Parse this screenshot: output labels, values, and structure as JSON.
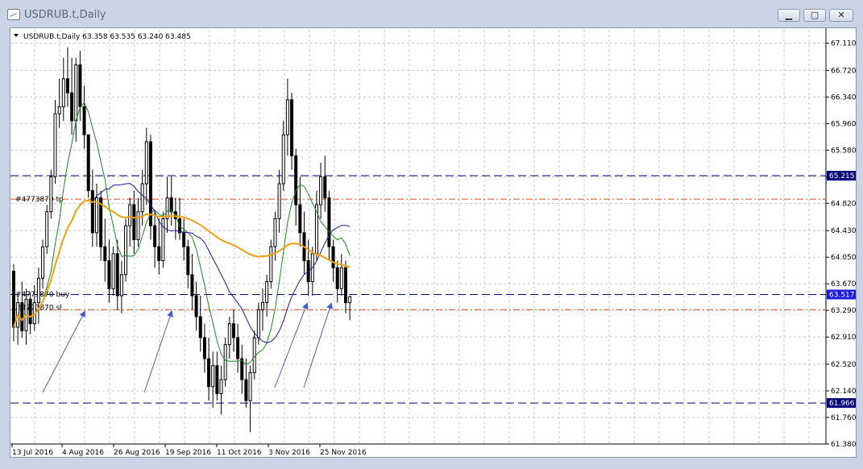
{
  "window": {
    "title": "USDRUB.t,Daily",
    "minimize_icon": "minimize-icon",
    "maximize_icon": "maximize-icon",
    "close_icon": "close-icon"
  },
  "header": {
    "symbol": "USDRUB.t,Daily",
    "ohlc": "63.358 63.535 63.240 63.485"
  },
  "chart_data": {
    "type": "candlestick",
    "title": "USDRUB.t,Daily",
    "ylim": [
      61.38,
      67.3
    ],
    "y_ticks": [
      "67.110",
      "66.720",
      "66.340",
      "65.960",
      "65.580",
      "65.200",
      "64.820",
      "64.430",
      "64.050",
      "63.670",
      "63.290",
      "62.910",
      "62.520",
      "62.140",
      "61.760",
      "61.380"
    ],
    "x_ticks": [
      "13 Jul 2016",
      "4 Aug 2016",
      "26 Aug 2016",
      "19 Sep 2016",
      "11 Oct 2016",
      "3 Nov 2016",
      "25 Nov 2016"
    ],
    "horizontal_levels": [
      {
        "label": "65.215",
        "value": 65.215,
        "style": "dashed",
        "color": "#000080"
      },
      {
        "label": "",
        "value": 64.88,
        "style": "dashdot",
        "color": "#e05020"
      },
      {
        "label": "63.517",
        "value": 63.517,
        "style": "dashed",
        "color": "#000080"
      },
      {
        "label": "",
        "value": 63.3,
        "style": "dashdot",
        "color": "#e05020"
      },
      {
        "label": "61.966",
        "value": 61.966,
        "style": "dashed",
        "color": "#000080"
      }
    ],
    "order_labels": [
      "#4773870 tp",
      "#4773870 buy",
      "#4773870 sl"
    ],
    "candles": [
      [
        63.85,
        63.95,
        62.85,
        63.05
      ],
      [
        63.05,
        63.5,
        62.8,
        63.4
      ],
      [
        63.4,
        63.7,
        62.9,
        63.0
      ],
      [
        63.0,
        63.6,
        62.8,
        63.45
      ],
      [
        63.45,
        63.55,
        62.95,
        63.1
      ],
      [
        63.1,
        63.65,
        63.0,
        63.4
      ],
      [
        63.4,
        63.9,
        63.1,
        63.75
      ],
      [
        63.75,
        64.3,
        63.6,
        64.2
      ],
      [
        64.2,
        64.8,
        64.1,
        64.7
      ],
      [
        64.7,
        65.3,
        64.6,
        65.2
      ],
      [
        65.2,
        66.3,
        65.1,
        66.1
      ],
      [
        66.1,
        66.6,
        65.9,
        66.2
      ],
      [
        66.2,
        66.9,
        66.0,
        66.6
      ],
      [
        66.6,
        67.05,
        66.2,
        66.4
      ],
      [
        66.4,
        66.9,
        65.8,
        66.0
      ],
      [
        66.0,
        66.9,
        65.7,
        66.8
      ],
      [
        66.8,
        67.0,
        66.0,
        66.2
      ],
      [
        66.2,
        66.5,
        65.6,
        65.8
      ],
      [
        65.8,
        65.8,
        64.9,
        65.0
      ],
      [
        65.0,
        65.3,
        64.2,
        64.4
      ],
      [
        64.4,
        65.1,
        64.2,
        64.9
      ],
      [
        64.9,
        65.0,
        64.0,
        64.2
      ],
      [
        64.2,
        64.6,
        63.7,
        64.0
      ],
      [
        64.0,
        64.3,
        63.4,
        63.6
      ],
      [
        63.6,
        64.2,
        63.5,
        64.1
      ],
      [
        64.1,
        64.3,
        63.3,
        63.5
      ],
      [
        63.5,
        64.0,
        63.25,
        63.8
      ],
      [
        63.8,
        64.6,
        63.7,
        64.5
      ],
      [
        64.5,
        64.9,
        64.2,
        64.8
      ],
      [
        64.8,
        65.0,
        64.1,
        64.3
      ],
      [
        64.3,
        64.9,
        64.2,
        64.7
      ],
      [
        64.7,
        65.3,
        64.5,
        65.1
      ],
      [
        65.1,
        65.9,
        64.8,
        65.7
      ],
      [
        65.7,
        65.8,
        64.3,
        64.5
      ],
      [
        64.5,
        64.7,
        63.9,
        64.2
      ],
      [
        64.2,
        64.6,
        63.8,
        64.0
      ],
      [
        64.0,
        64.7,
        63.9,
        64.6
      ],
      [
        64.6,
        65.2,
        64.4,
        64.9
      ],
      [
        64.9,
        65.2,
        64.5,
        64.7
      ],
      [
        64.7,
        64.9,
        64.3,
        64.6
      ],
      [
        64.6,
        64.9,
        64.3,
        64.4
      ],
      [
        64.4,
        64.6,
        64.0,
        64.2
      ],
      [
        64.2,
        64.3,
        63.6,
        63.8
      ],
      [
        63.8,
        64.1,
        63.3,
        63.5
      ],
      [
        63.5,
        63.7,
        63.0,
        63.2
      ],
      [
        63.2,
        63.5,
        62.7,
        62.9
      ],
      [
        62.9,
        63.1,
        62.4,
        62.6
      ],
      [
        62.6,
        62.9,
        62.0,
        62.2
      ],
      [
        62.2,
        62.7,
        61.9,
        62.5
      ],
      [
        62.5,
        62.7,
        62.0,
        62.1
      ],
      [
        62.1,
        62.5,
        61.8,
        62.3
      ],
      [
        62.3,
        62.9,
        62.2,
        62.8
      ],
      [
        62.8,
        63.2,
        62.6,
        63.1
      ],
      [
        63.1,
        63.3,
        62.7,
        62.9
      ],
      [
        62.9,
        63.1,
        62.4,
        62.6
      ],
      [
        62.6,
        62.8,
        62.1,
        62.3
      ],
      [
        62.3,
        62.6,
        61.9,
        62.0
      ],
      [
        62.0,
        62.5,
        61.55,
        62.4
      ],
      [
        62.4,
        63.0,
        62.3,
        62.9
      ],
      [
        62.9,
        63.4,
        62.8,
        63.3
      ],
      [
        63.3,
        63.6,
        63.0,
        63.4
      ],
      [
        63.4,
        63.8,
        63.2,
        63.7
      ],
      [
        63.7,
        64.3,
        63.6,
        64.2
      ],
      [
        64.2,
        64.7,
        64.0,
        64.6
      ],
      [
        64.6,
        65.3,
        64.4,
        65.1
      ],
      [
        65.1,
        66.0,
        65.0,
        65.8
      ],
      [
        65.8,
        66.6,
        65.5,
        66.3
      ],
      [
        66.3,
        66.4,
        65.3,
        65.5
      ],
      [
        65.5,
        65.6,
        64.5,
        64.8
      ],
      [
        64.8,
        65.2,
        64.2,
        64.4
      ],
      [
        64.4,
        64.7,
        63.8,
        64.0
      ],
      [
        64.0,
        64.3,
        63.5,
        63.7
      ],
      [
        63.7,
        64.2,
        63.5,
        64.1
      ],
      [
        64.1,
        65.0,
        64.0,
        64.8
      ],
      [
        64.8,
        65.4,
        64.6,
        65.2
      ],
      [
        65.2,
        65.5,
        64.7,
        64.9
      ],
      [
        64.9,
        65.0,
        64.0,
        64.2
      ],
      [
        64.2,
        64.3,
        63.7,
        63.9
      ],
      [
        63.9,
        64.0,
        63.4,
        63.6
      ],
      [
        63.6,
        64.1,
        63.5,
        63.9
      ],
      [
        63.9,
        64.0,
        63.25,
        63.4
      ],
      [
        63.4,
        63.5,
        63.15,
        63.485
      ]
    ]
  },
  "annotations": {
    "arrows": 5
  }
}
